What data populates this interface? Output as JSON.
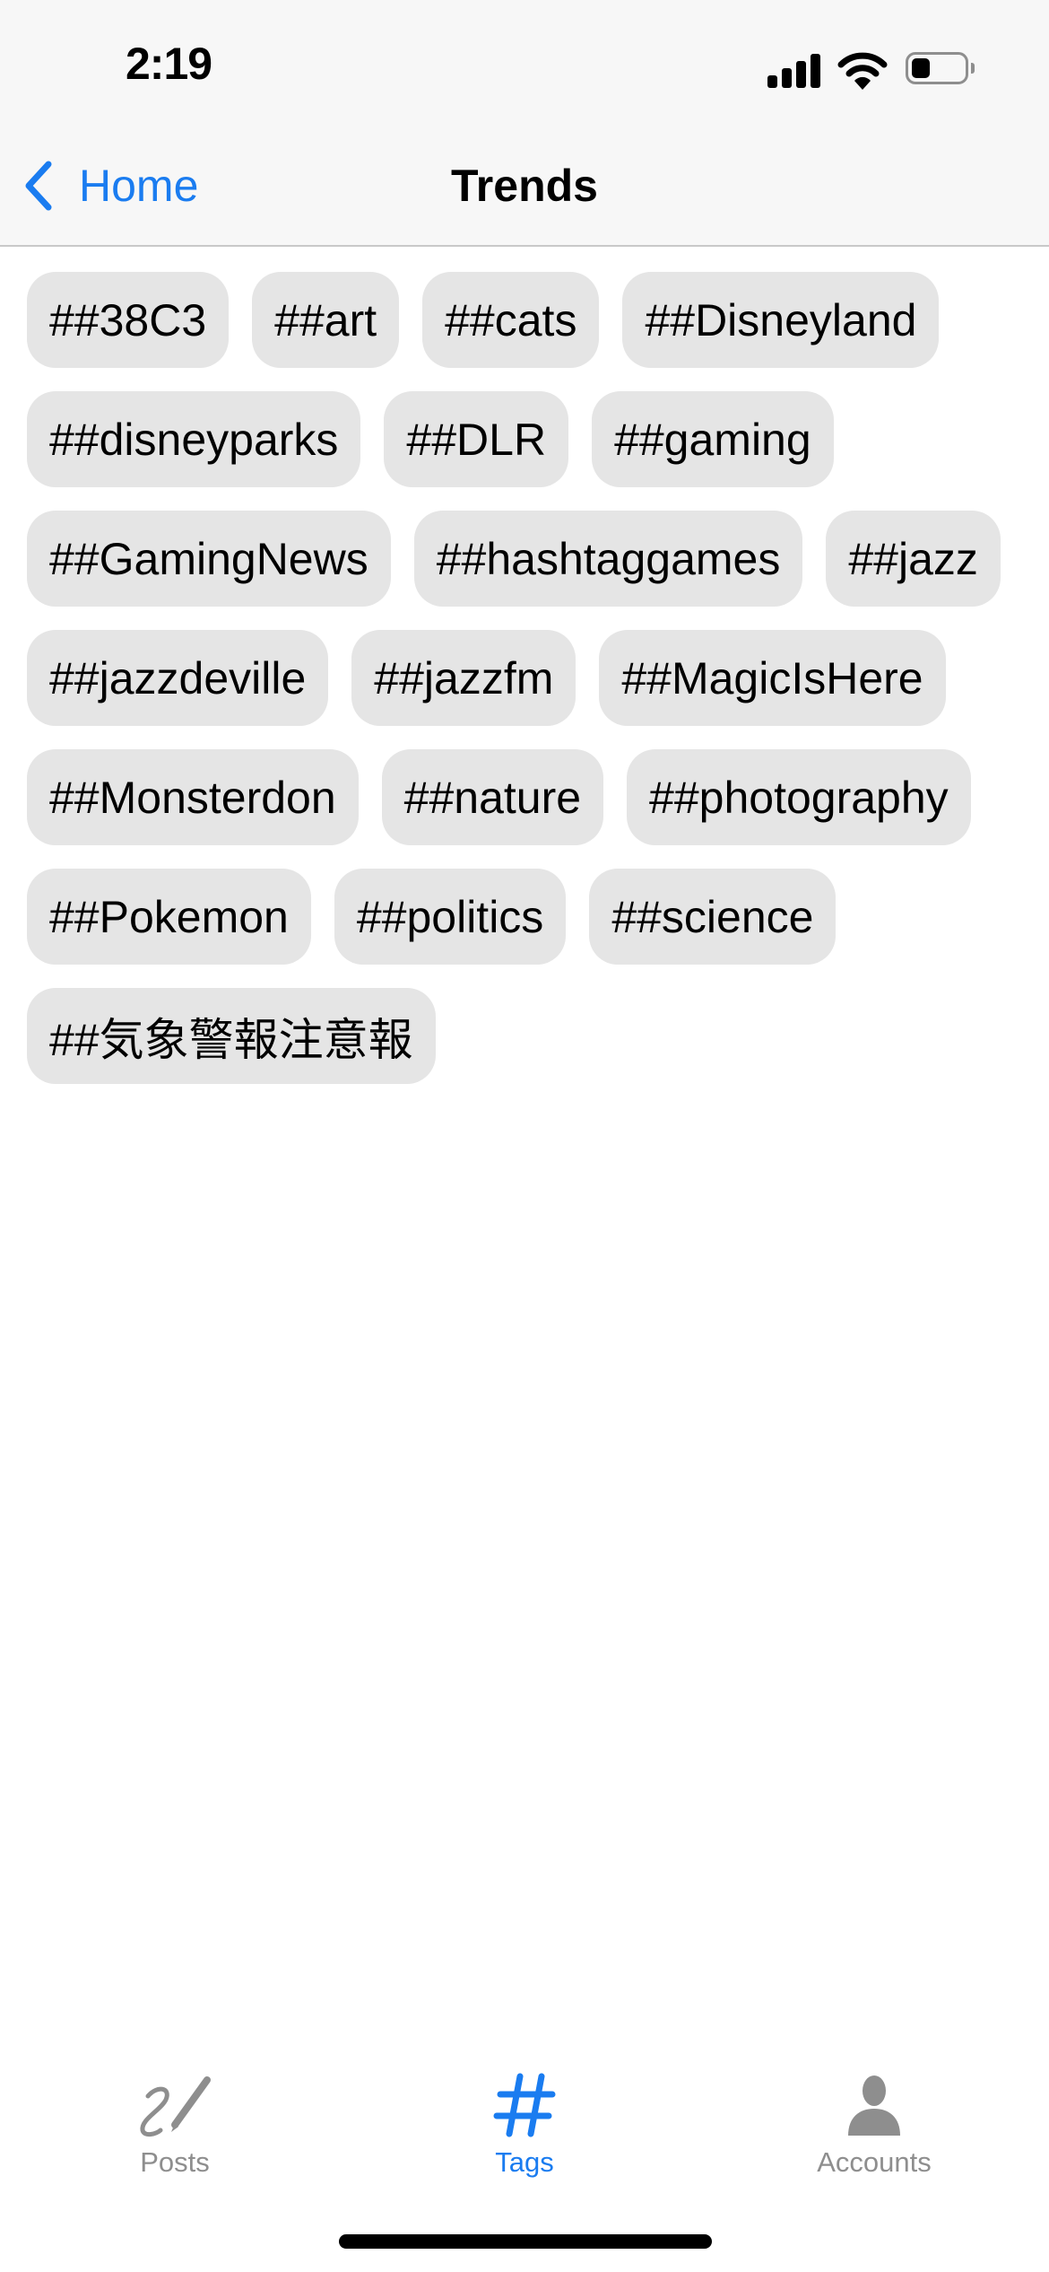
{
  "status_bar": {
    "time": "2:19",
    "signal_bars": 4,
    "battery_level_percent": 35
  },
  "nav": {
    "back_label": "Home",
    "back_icon": "chevron-left-icon",
    "title": "Trends"
  },
  "tags": [
    "##38C3",
    "##art",
    "##cats",
    "##Disneyland",
    "##disneyparks",
    "##DLR",
    "##gaming",
    "##GamingNews",
    "##hashtaggames",
    "##jazz",
    "##jazzdeville",
    "##jazzfm",
    "##MagicIsHere",
    "##Monsterdon",
    "##nature",
    "##photography",
    "##Pokemon",
    "##politics",
    "##science",
    "##気象警報注意報"
  ],
  "tab_bar": {
    "active": "Tags",
    "items": [
      {
        "label": "Posts",
        "icon": "signature-pen-icon"
      },
      {
        "label": "Tags",
        "icon": "hashtag-icon"
      },
      {
        "label": "Accounts",
        "icon": "person-icon"
      }
    ]
  },
  "colors": {
    "accent": "#1a7cf0",
    "chip_background": "#e5e5e5",
    "inactive_tab": "#8e8e8e"
  }
}
